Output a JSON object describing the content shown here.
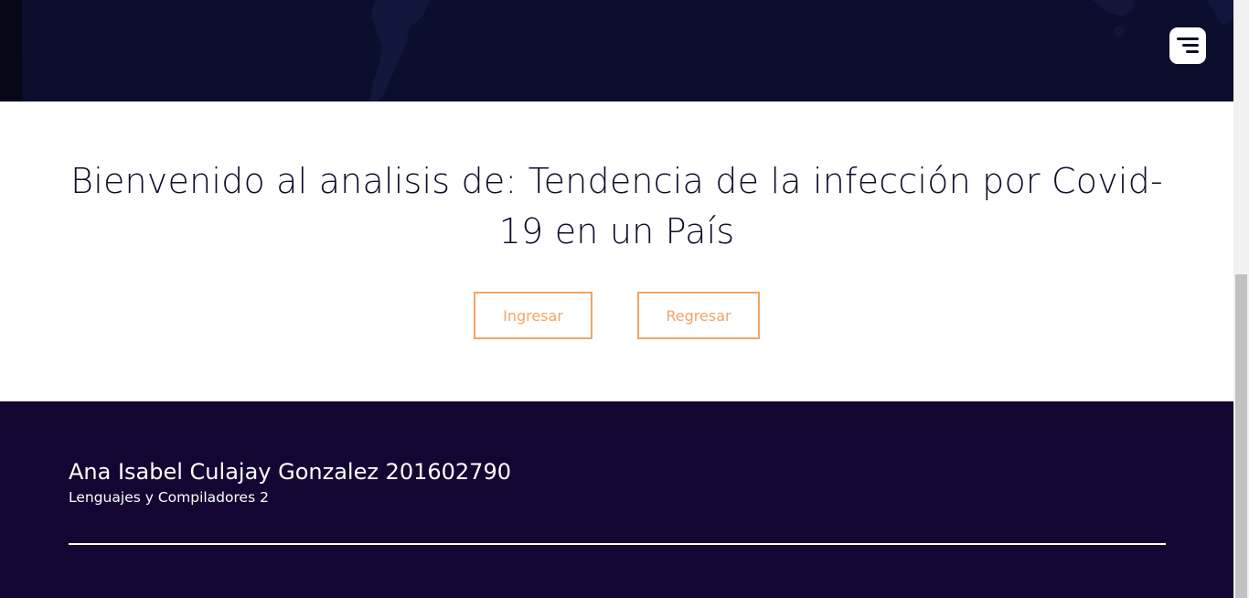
{
  "header": {
    "menu_icon": "hamburger-menu-icon"
  },
  "main": {
    "headline": "Bienvenido al analisis de: Tendencia de la infección por Covid-19 en un País",
    "buttons": {
      "ingresar": "Ingresar",
      "regresar": "Regresar"
    },
    "button_color": "#f2a465"
  },
  "footer": {
    "name": "Ana Isabel Culajay Gonzalez 201602790",
    "course": "Lenguajes y Compiladores 2",
    "background": "#150532"
  },
  "colors": {
    "hero_background": "#0b0d2c",
    "headline_text": "#0f0d2a"
  }
}
